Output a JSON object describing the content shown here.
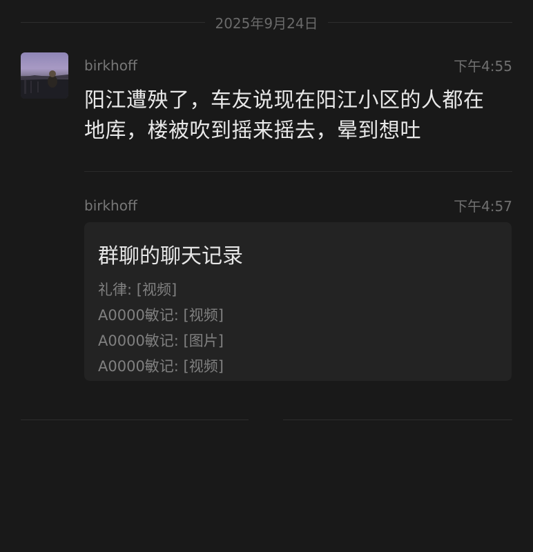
{
  "date_divider": "2025年9月24日",
  "messages": [
    {
      "sender": "birkhoff",
      "time": "下午4:55",
      "text_line1": "阳江遭殃了，车友说现在阳江小区的人都在",
      "text_line2": "地库，楼被吹到摇来摇去，晕到想吐"
    },
    {
      "sender": "birkhoff",
      "time": "下午4:57",
      "forwarded_card": {
        "title": "群聊的聊天记录",
        "lines": [
          "礼律: [视频]",
          "A0000敏记: [视频]",
          "A0000敏记: [图片]",
          "A0000敏记: [视频]"
        ]
      }
    }
  ],
  "colors": {
    "background": "#191919",
    "card": "#232323",
    "text_primary": "#e8e8e8",
    "text_secondary": "#808080"
  }
}
